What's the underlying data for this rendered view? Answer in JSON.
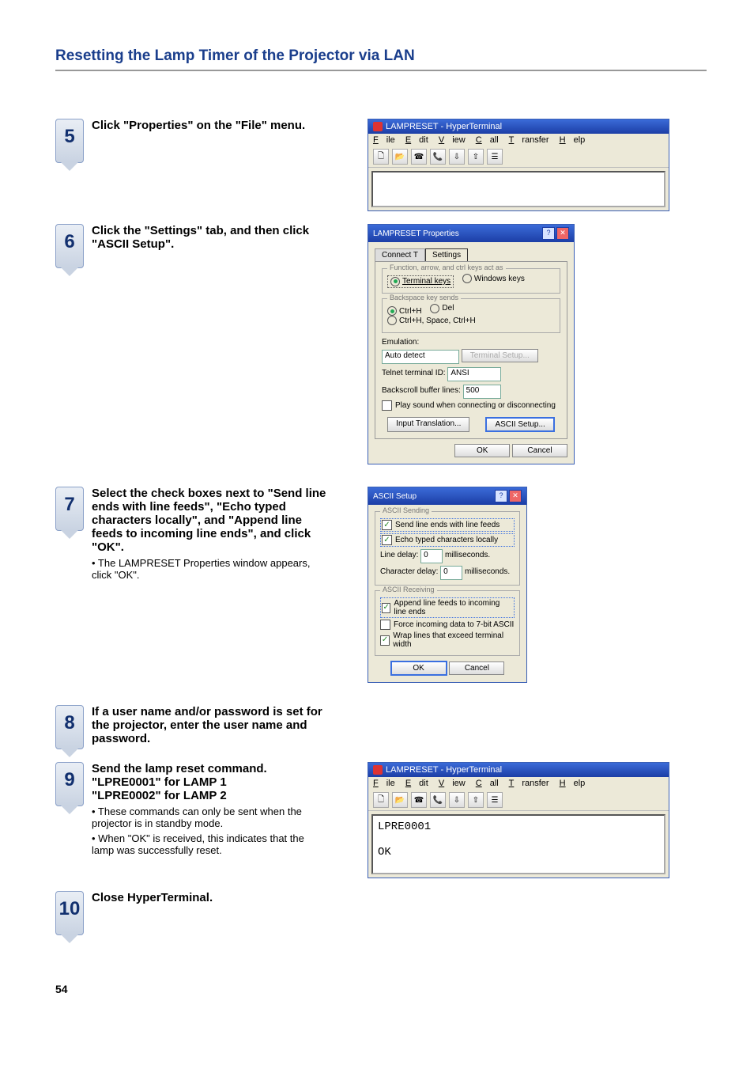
{
  "page": {
    "title": "Resetting the Lamp Timer of the Projector via LAN",
    "number": "54"
  },
  "hyperterminal": {
    "title": "LAMPRESET - HyperTerminal",
    "menu": {
      "file": "File",
      "edit": "Edit",
      "view": "View",
      "call": "Call",
      "transfer": "Transfer",
      "help": "Help"
    },
    "term2_lines": "LPRE0001\n\nOK"
  },
  "steps": {
    "s5": {
      "num": "5",
      "text": "Click \"Properties\" on the \"File\" menu."
    },
    "s6": {
      "num": "6",
      "text": "Click the \"Settings\" tab, and then click \"ASCII Setup\"."
    },
    "s7": {
      "num": "7",
      "text": "Select the check boxes next to \"Send line ends with line feeds\", \"Echo typed characters locally\", and \"Append line feeds to incoming line ends\", and click \"OK\".",
      "sub": "• The LAMPRESET Properties window appears, click \"OK\"."
    },
    "s8": {
      "num": "8",
      "text": "If a user name and/or password is set for the projector, enter the user name and password."
    },
    "s9": {
      "num": "9",
      "text": "Send the lamp reset command.",
      "l1": "\"LPRE0001\" for LAMP 1",
      "l2": "\"LPRE0002\" for LAMP 2",
      "sub1": "• These commands can only be sent when the projector is in standby mode.",
      "sub2": "• When \"OK\" is received, this indicates that the lamp was successfully reset."
    },
    "s10": {
      "num": "10",
      "text": "Close HyperTerminal."
    }
  },
  "props_dialog": {
    "title": "LAMPRESET Properties",
    "tab_connect": "Connect T",
    "tab_settings": "Settings",
    "group_func": "Function, arrow, and ctrl keys act as",
    "opt_terminal": "Terminal keys",
    "opt_windows": "Windows keys",
    "group_bksp": "Backspace key sends",
    "opt_ctrlh": "Ctrl+H",
    "opt_del": "Del",
    "opt_ctrlh2": "Ctrl+H, Space, Ctrl+H",
    "emulation_lbl": "Emulation:",
    "emulation_val": "Auto detect",
    "term_setup": "Terminal Setup...",
    "telnet_lbl": "Telnet terminal ID:",
    "telnet_val": "ANSI",
    "backscroll_lbl": "Backscroll buffer lines:",
    "backscroll_val": "500",
    "play_sound": "Play sound when connecting or disconnecting",
    "input_trans": "Input Translation...",
    "ascii_setup": "ASCII Setup...",
    "ok": "OK",
    "cancel": "Cancel"
  },
  "ascii_dialog": {
    "title": "ASCII Setup",
    "grp_send": "ASCII Sending",
    "send_line": "Send line ends with line feeds",
    "echo": "Echo typed characters locally",
    "line_delay_lbl": "Line delay:",
    "line_delay_val": "0",
    "ms": "milliseconds.",
    "char_delay_lbl": "Character delay:",
    "char_delay_val": "0",
    "grp_recv": "ASCII Receiving",
    "append": "Append line feeds to incoming line ends",
    "force7": "Force incoming data to 7-bit ASCII",
    "wrap": "Wrap lines that exceed terminal width",
    "ok": "OK",
    "cancel": "Cancel"
  }
}
